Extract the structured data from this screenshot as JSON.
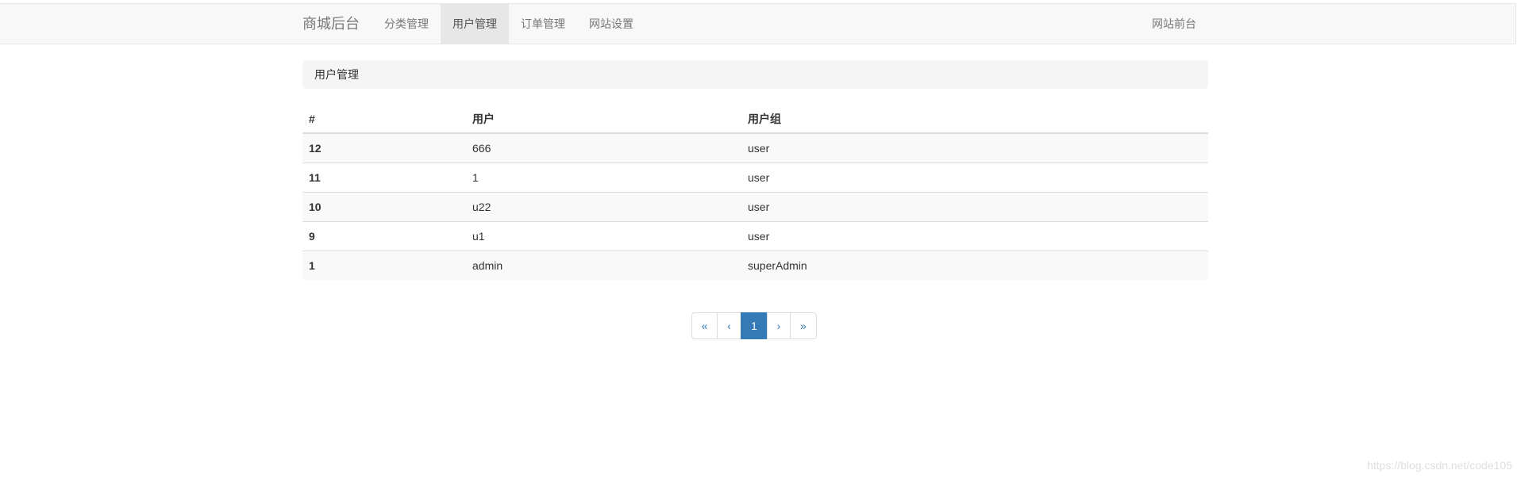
{
  "navbar": {
    "brand": "商城后台",
    "items": [
      {
        "label": "分类管理",
        "active": false
      },
      {
        "label": "用户管理",
        "active": true
      },
      {
        "label": "订单管理",
        "active": false
      },
      {
        "label": "网站设置",
        "active": false
      }
    ],
    "right_link": "网站前台"
  },
  "panel": {
    "title": "用户管理"
  },
  "table": {
    "headers": [
      "#",
      "用户",
      "用户组"
    ],
    "rows": [
      [
        "12",
        "666",
        "user"
      ],
      [
        "11",
        "1",
        "user"
      ],
      [
        "10",
        "u22",
        "user"
      ],
      [
        "9",
        "u1",
        "user"
      ],
      [
        "1",
        "admin",
        "superAdmin"
      ]
    ]
  },
  "pagination": {
    "first": "«",
    "prev": "‹",
    "current": "1",
    "next": "›",
    "last": "»"
  },
  "watermark": "https://blog.csdn.net/code105",
  "colors": {
    "navbar_bg": "#f8f8f8",
    "active_tab_bg": "#e7e7e7",
    "link": "#337ab7",
    "striped_row": "#f9f9f9"
  }
}
